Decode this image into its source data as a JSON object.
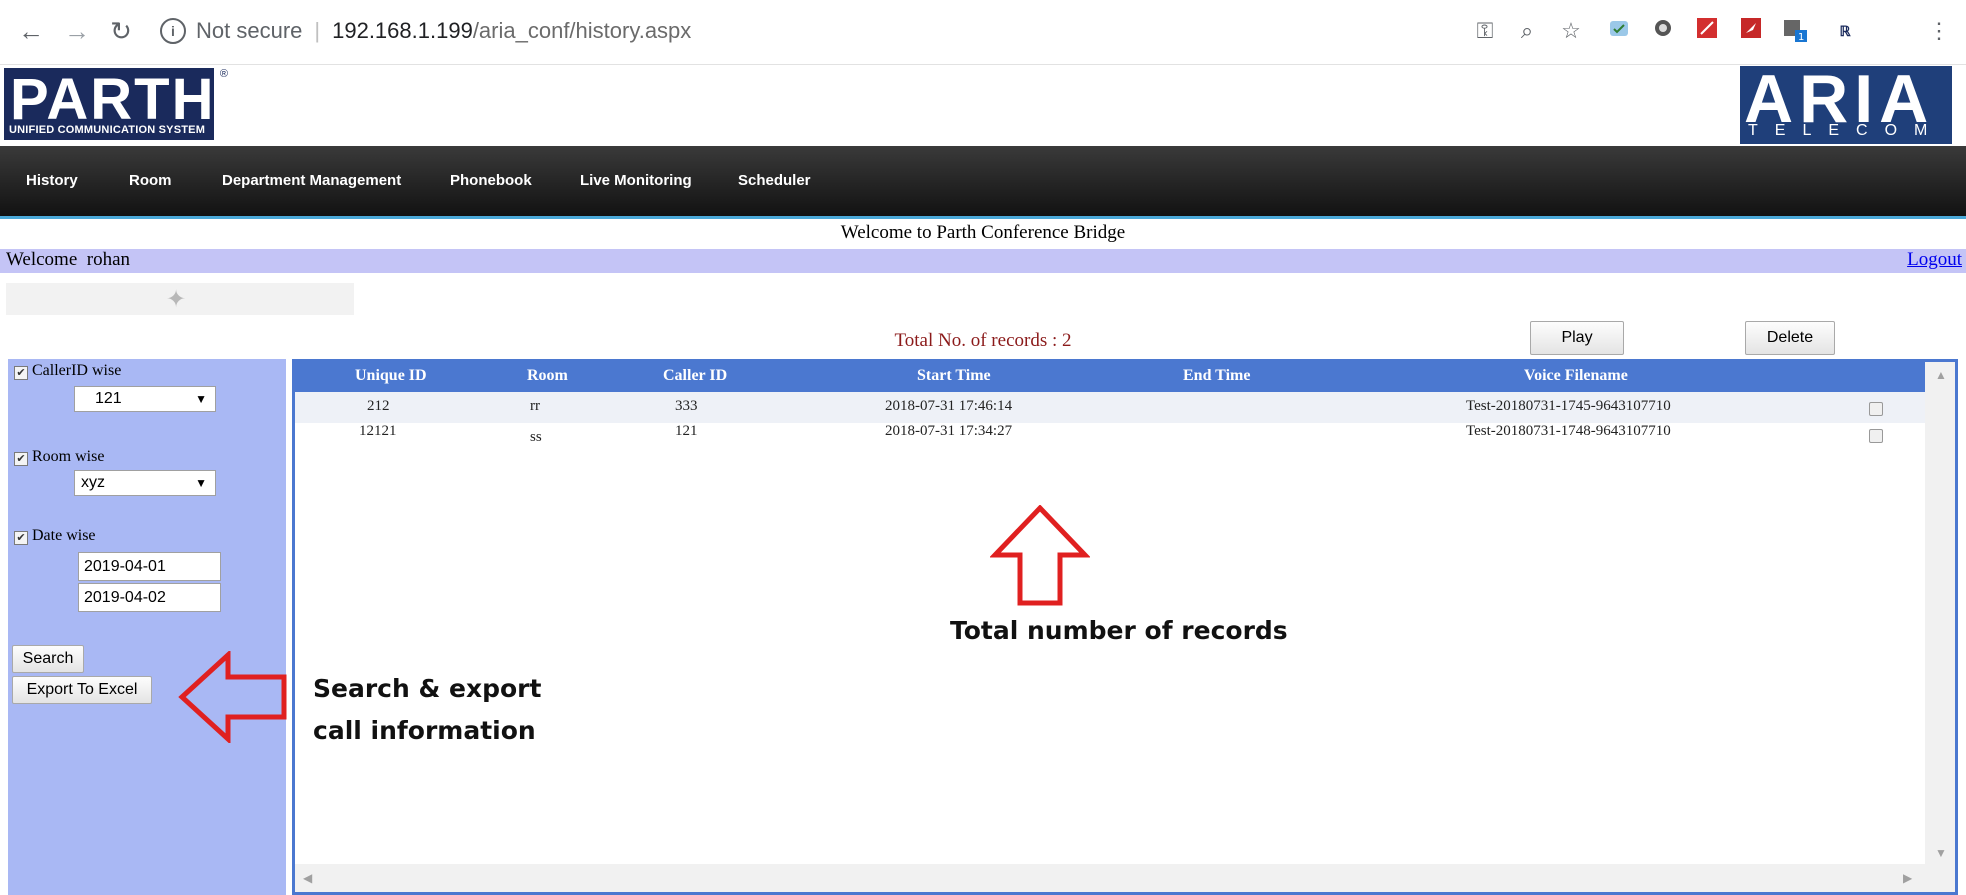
{
  "browser": {
    "security": "Not secure",
    "host": "192.168.1.199",
    "path": "/aria_conf/history.aspx"
  },
  "logos": {
    "parth_name": "PARTH",
    "parth_tagline": "UNIFIED COMMUNICATION SYSTEM",
    "aria_name": "ARIA",
    "aria_tagline": "TELECOM"
  },
  "nav": {
    "items": [
      "History",
      "Room",
      "Department Management",
      "Phonebook",
      "Live Monitoring",
      "Scheduler"
    ]
  },
  "page": {
    "banner": "Welcome to Parth Conference Bridge",
    "welcome_label": "Welcome",
    "username": "rohan",
    "logout": "Logout",
    "total_records": "Total No. of records : 2"
  },
  "actions": {
    "play": "Play",
    "delete": "Delete"
  },
  "filters": {
    "callerid_label": "CallerID wise",
    "callerid_value": "121",
    "room_label": "Room wise",
    "room_value": "xyz",
    "date_label": "Date wise",
    "date_from": "2019-04-01",
    "date_to": "2019-04-02",
    "search": "Search",
    "export": "Export To Excel"
  },
  "table": {
    "columns": [
      "Unique ID",
      "Room",
      "Caller ID",
      "Start Time",
      "End Time",
      "Voice Filename"
    ],
    "rows": [
      [
        "212",
        "rr",
        "333",
        "2018-07-31 17:46:14",
        "",
        "Test-20180731-1745-9643107710"
      ],
      [
        "12121",
        "ss",
        "121",
        "2018-07-31 17:34:27",
        "",
        "Test-20180731-1748-9643107710"
      ]
    ]
  },
  "annotations": {
    "records_note": "Total number of records",
    "search_note_line1": "Search & export",
    "search_note_line2": "call information",
    "arrow_color": "#e02020"
  }
}
